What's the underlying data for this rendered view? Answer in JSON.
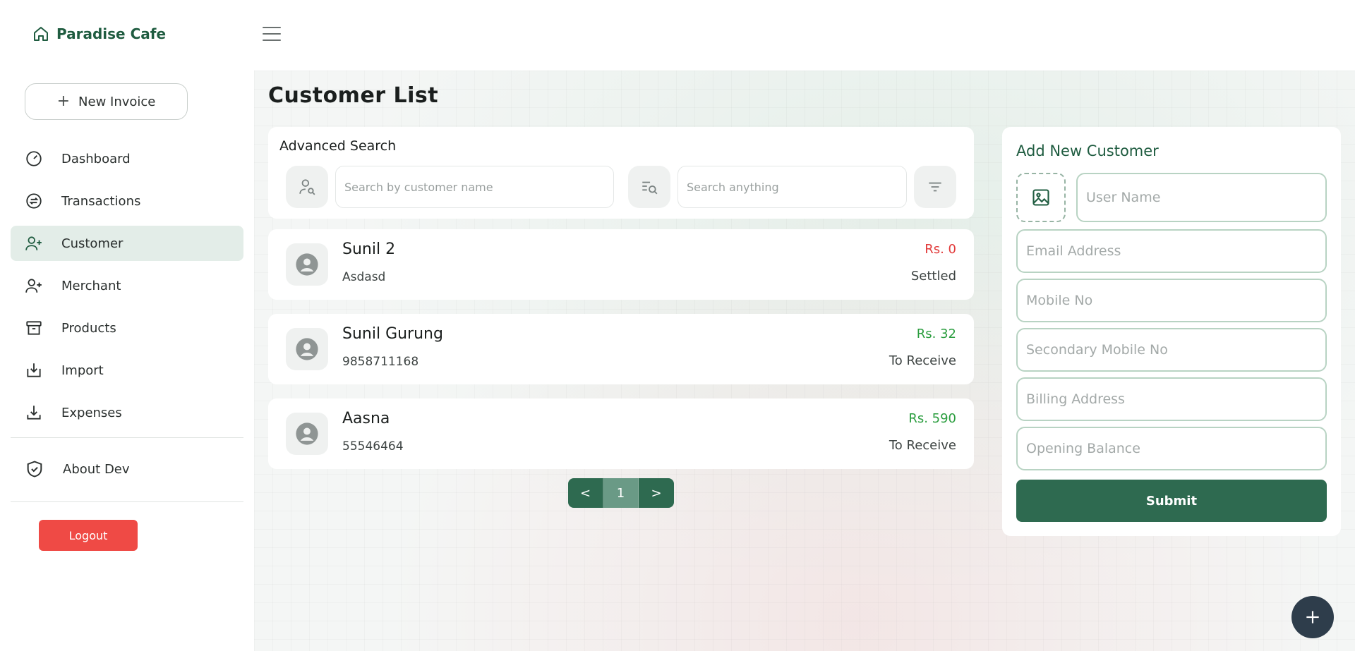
{
  "brand": {
    "name": "Paradise Cafe",
    "icon": "home-icon"
  },
  "sidebar": {
    "new_invoice_label": "New Invoice",
    "items": [
      {
        "label": "Dashboard",
        "icon": "dashboard-icon"
      },
      {
        "label": "Transactions",
        "icon": "transactions-icon"
      },
      {
        "label": "Customer",
        "icon": "user-plus-icon",
        "active": true
      },
      {
        "label": "Merchant",
        "icon": "user-plus-icon"
      },
      {
        "label": "Products",
        "icon": "archive-icon"
      },
      {
        "label": "Import",
        "icon": "import-icon"
      },
      {
        "label": "Expenses",
        "icon": "download-icon"
      }
    ],
    "about_label": "About Dev",
    "logout_label": "Logout"
  },
  "page": {
    "title": "Customer List"
  },
  "search": {
    "title": "Advanced Search",
    "name_placeholder": "Search by customer name",
    "any_placeholder": "Search anything"
  },
  "customers": [
    {
      "name": "Sunil 2",
      "sub": "Asdasd",
      "amount": "Rs. 0",
      "status": "Settled",
      "amount_color": "#e23b3b"
    },
    {
      "name": "Sunil Gurung",
      "sub": "9858711168",
      "amount": "Rs. 32",
      "status": "To Receive",
      "amount_color": "#2a9d3e"
    },
    {
      "name": "Aasna",
      "sub": "55546464",
      "amount": "Rs. 590",
      "status": "To Receive",
      "amount_color": "#2a9d3e"
    }
  ],
  "pagination": {
    "prev": "<",
    "current": "1",
    "next": ">"
  },
  "add_customer": {
    "title": "Add New Customer",
    "username_placeholder": "User Name",
    "email_placeholder": "Email Address",
    "mobile_placeholder": "Mobile No",
    "secondary_mobile_placeholder": "Secondary Mobile No",
    "billing_placeholder": "Billing Address",
    "opening_balance_placeholder": "Opening Balance",
    "submit_label": "Submit"
  },
  "colors": {
    "brand": "#1f5c40",
    "accent": "#2e6a50",
    "danger": "#ef4a45"
  }
}
